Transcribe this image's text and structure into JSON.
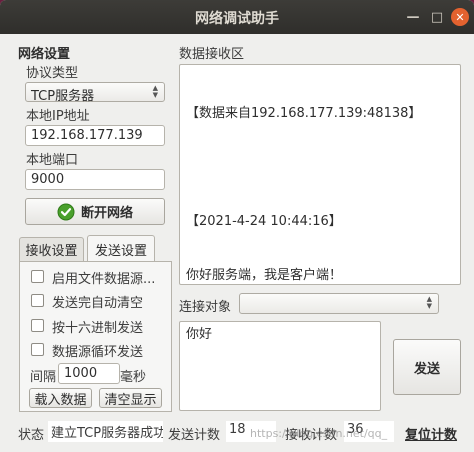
{
  "window": {
    "title": "网络调试助手",
    "close_glyph": "✕",
    "minimize_glyph": "—",
    "restore_glyph": "□"
  },
  "network": {
    "section_title": "网络设置",
    "protocol_label": "协议类型",
    "protocol_value": "TCP服务器",
    "ip_label": "本地IP地址",
    "ip_value": "192.168.177.139",
    "port_label": "本地端口",
    "port_value": "9000",
    "disconnect_label": "断开网络"
  },
  "tabs": {
    "receive_settings": "接收设置",
    "send_settings": "发送设置"
  },
  "send_settings": {
    "opt_file_source": "启用文件数据源...",
    "opt_auto_clear": "发送完自动清空",
    "opt_hex": "按十六进制发送",
    "opt_loop": "数据源循环发送",
    "interval_label": "间隔",
    "interval_value": "1000",
    "interval_unit": "毫秒",
    "load_data": "载入数据",
    "clear_display": "清空显示"
  },
  "receive": {
    "section_title": "数据接收区",
    "line1": "【数据来自192.168.177.139:48138】",
    "line2": "",
    "line3": "【2021-4-24 10:44:16】",
    "line4": "你好服务端，我是客户端！"
  },
  "connection": {
    "label": "连接对象",
    "value": ""
  },
  "send": {
    "text": "你好",
    "button_label": "发送"
  },
  "status": {
    "label": "状态",
    "value": "建立TCP服务器成功",
    "send_count_label": "发送计数",
    "send_count": "18",
    "recv_count_label": "接收计数",
    "recv_count": "36",
    "reset_label": "复位计数"
  },
  "watermark": "https://blog.csdn.net/qq_",
  "colors": {
    "close_button": "#e3622f",
    "titlebar": "#2f2e2b",
    "ok_icon": "#4aa02c"
  },
  "icons": {
    "disconnect_icon": "check-circle-icon"
  }
}
